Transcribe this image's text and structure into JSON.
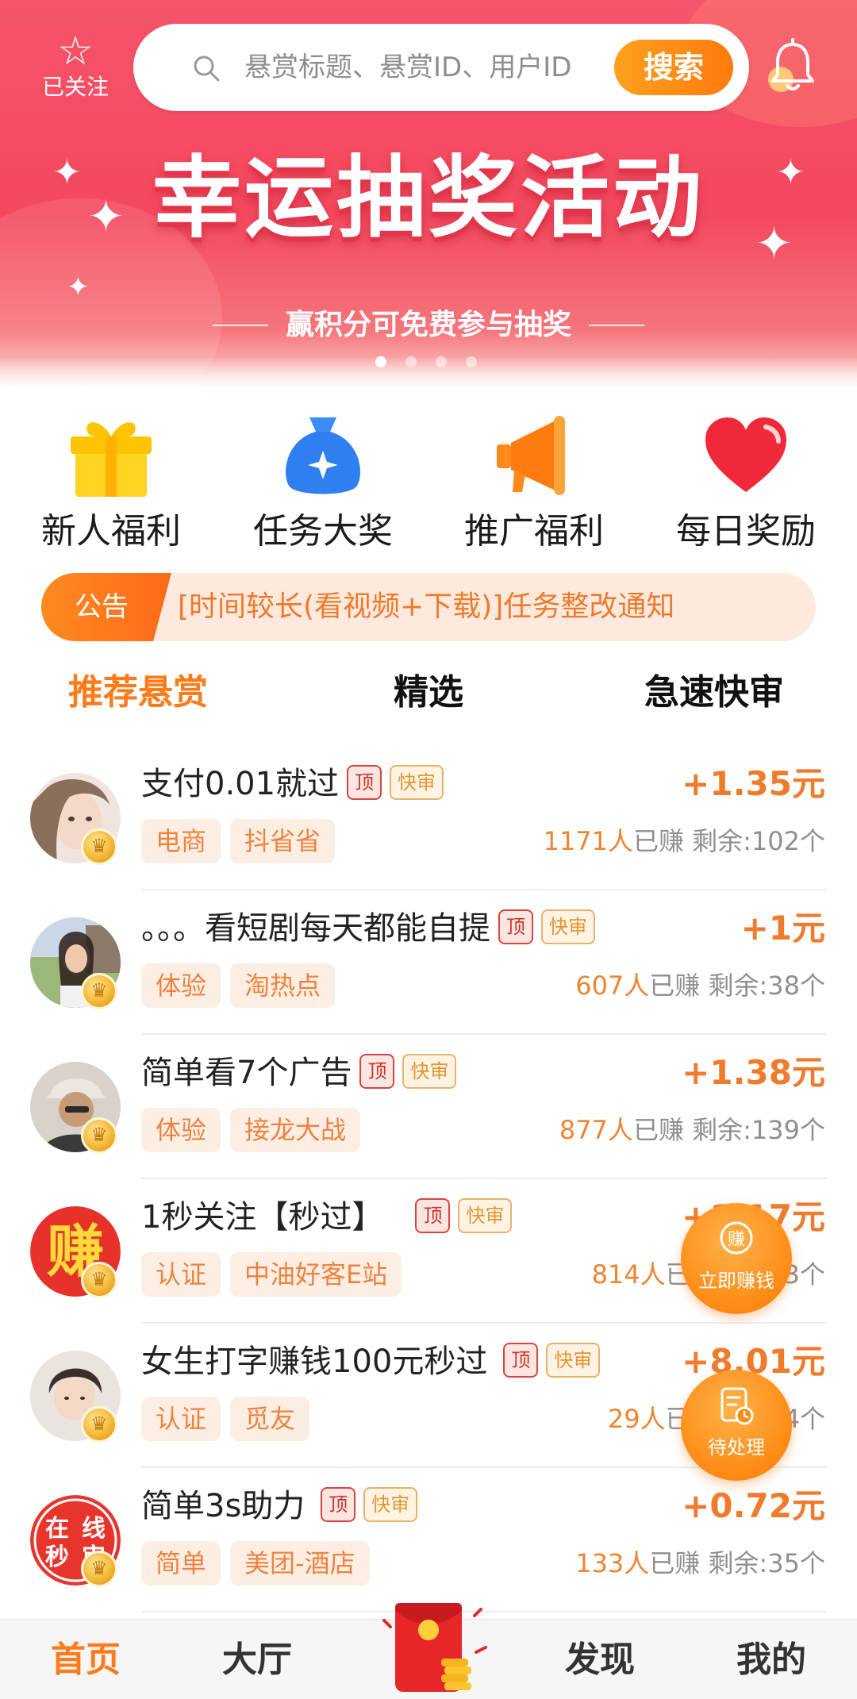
{
  "header": {
    "follow_label": "已关注",
    "search_placeholder": "悬赏标题、悬赏ID、用户ID",
    "search_button": "搜索"
  },
  "banner": {
    "title": "幸运抽奖活动",
    "subtitle": "赢积分可免费参与抽奖",
    "slide_count": 4,
    "active_slide": 1
  },
  "quick_nav": [
    {
      "label": "新人福利",
      "icon": "gift-icon"
    },
    {
      "label": "任务大奖",
      "icon": "money-bag-icon"
    },
    {
      "label": "推广福利",
      "icon": "megaphone-icon"
    },
    {
      "label": "每日奖励",
      "icon": "heart-icon"
    }
  ],
  "notice": {
    "tag": "公告",
    "message": "[时间较长(看视频+下载)]任务整改通知"
  },
  "tabs": [
    "推荐悬赏",
    "精选",
    "急速快审"
  ],
  "badges": {
    "top": "顶",
    "fast": "快审"
  },
  "tasks": [
    {
      "title": "支付0.01就过",
      "reward": "+1.35元",
      "tags": [
        "电商",
        "抖省省"
      ],
      "earned": "1171人",
      "earned_suffix": "已赚",
      "remaining": "剩余:102个"
    },
    {
      "title": "。。。看短剧每天都能自提",
      "reward": "+1元",
      "tags": [
        "体验",
        "淘热点"
      ],
      "earned": "607人",
      "earned_suffix": "已赚",
      "remaining": "剩余:38个"
    },
    {
      "title": "简单看7个广告",
      "reward": "+1.38元",
      "tags": [
        "体验",
        "接龙大战"
      ],
      "earned": "877人",
      "earned_suffix": "已赚",
      "remaining": "剩余:139个"
    },
    {
      "title": "1秒关注【秒过】",
      "reward": "+1.17元",
      "tags": [
        "认证",
        "中油好客E站"
      ],
      "earned": "814人",
      "earned_suffix": "已赚",
      "remaining": "剩余:3个"
    },
    {
      "title": "女生打字赚钱100元秒过",
      "reward": "+8.01元",
      "tags": [
        "认证",
        "觅友"
      ],
      "earned": "29人",
      "earned_suffix": "已赚",
      "remaining": "剩余:4个"
    },
    {
      "title": "简单3s助力",
      "reward": "+0.72元",
      "tags": [
        "简单",
        "美团-酒店"
      ],
      "earned": "133人",
      "earned_suffix": "已赚",
      "remaining": "剩余:35个"
    }
  ],
  "avatars": {
    "zhuan_char": "赚",
    "online_text": [
      "在",
      "线",
      "秒",
      "审"
    ]
  },
  "floating": {
    "earn_icon_char": "赚",
    "earn_label": "立即赚钱",
    "pending_label": "待处理"
  },
  "bottom_nav": [
    "首页",
    "大厅",
    "发现",
    "我的"
  ],
  "colors": {
    "accent": "#ff7a18",
    "banner": "#f4485e",
    "reward": "#ef7b2c"
  }
}
